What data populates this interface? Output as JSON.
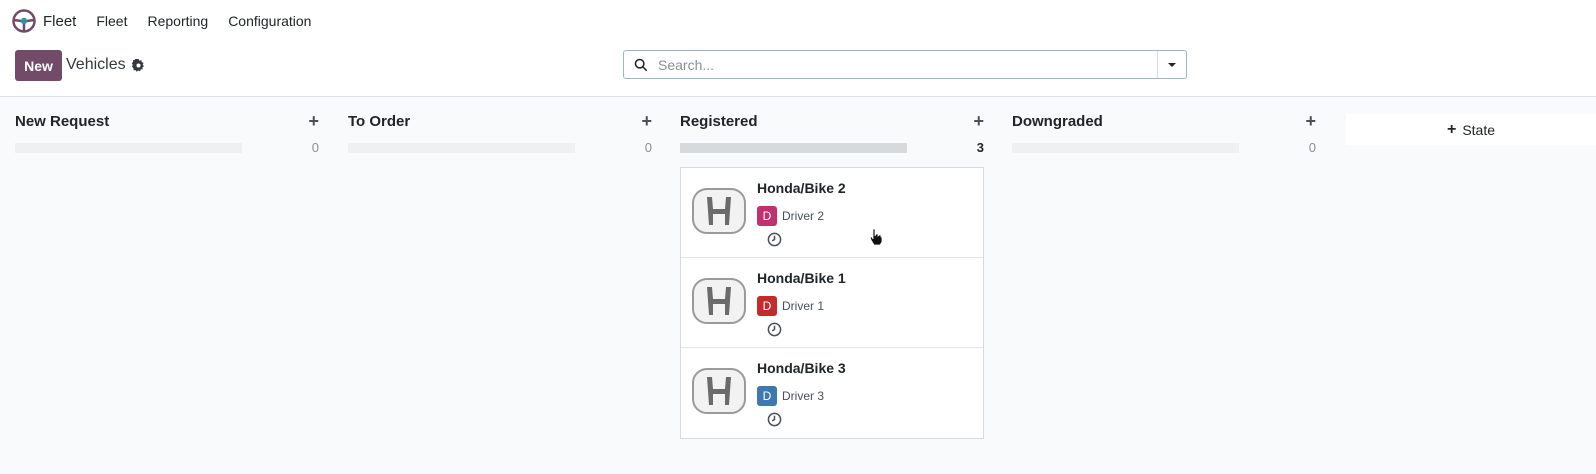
{
  "app": {
    "name": "Fleet"
  },
  "nav": {
    "items": [
      "Fleet",
      "Reporting",
      "Configuration"
    ]
  },
  "control": {
    "new_label": "New",
    "breadcrumb": "Vehicles",
    "search_placeholder": "Search..."
  },
  "kanban": {
    "columns": [
      {
        "title": "New Request",
        "count": "0",
        "progress": 0
      },
      {
        "title": "To Order",
        "count": "0",
        "progress": 0
      },
      {
        "title": "Registered",
        "count": "3",
        "progress": 1
      },
      {
        "title": "Downgraded",
        "count": "0",
        "progress": 0
      }
    ],
    "add_state_label": "State",
    "cards": [
      {
        "title": "Honda/Bike 2",
        "driver": "Driver 2",
        "avatar_letter": "D",
        "avatar_color": "#C0326D"
      },
      {
        "title": "Honda/Bike 1",
        "driver": "Driver 1",
        "avatar_letter": "D",
        "avatar_color": "#C42B2B"
      },
      {
        "title": "Honda/Bike 3",
        "driver": "Driver 3",
        "avatar_letter": "D",
        "avatar_color": "#3D78B0"
      }
    ]
  },
  "colors": {
    "brand": "#714B67"
  }
}
